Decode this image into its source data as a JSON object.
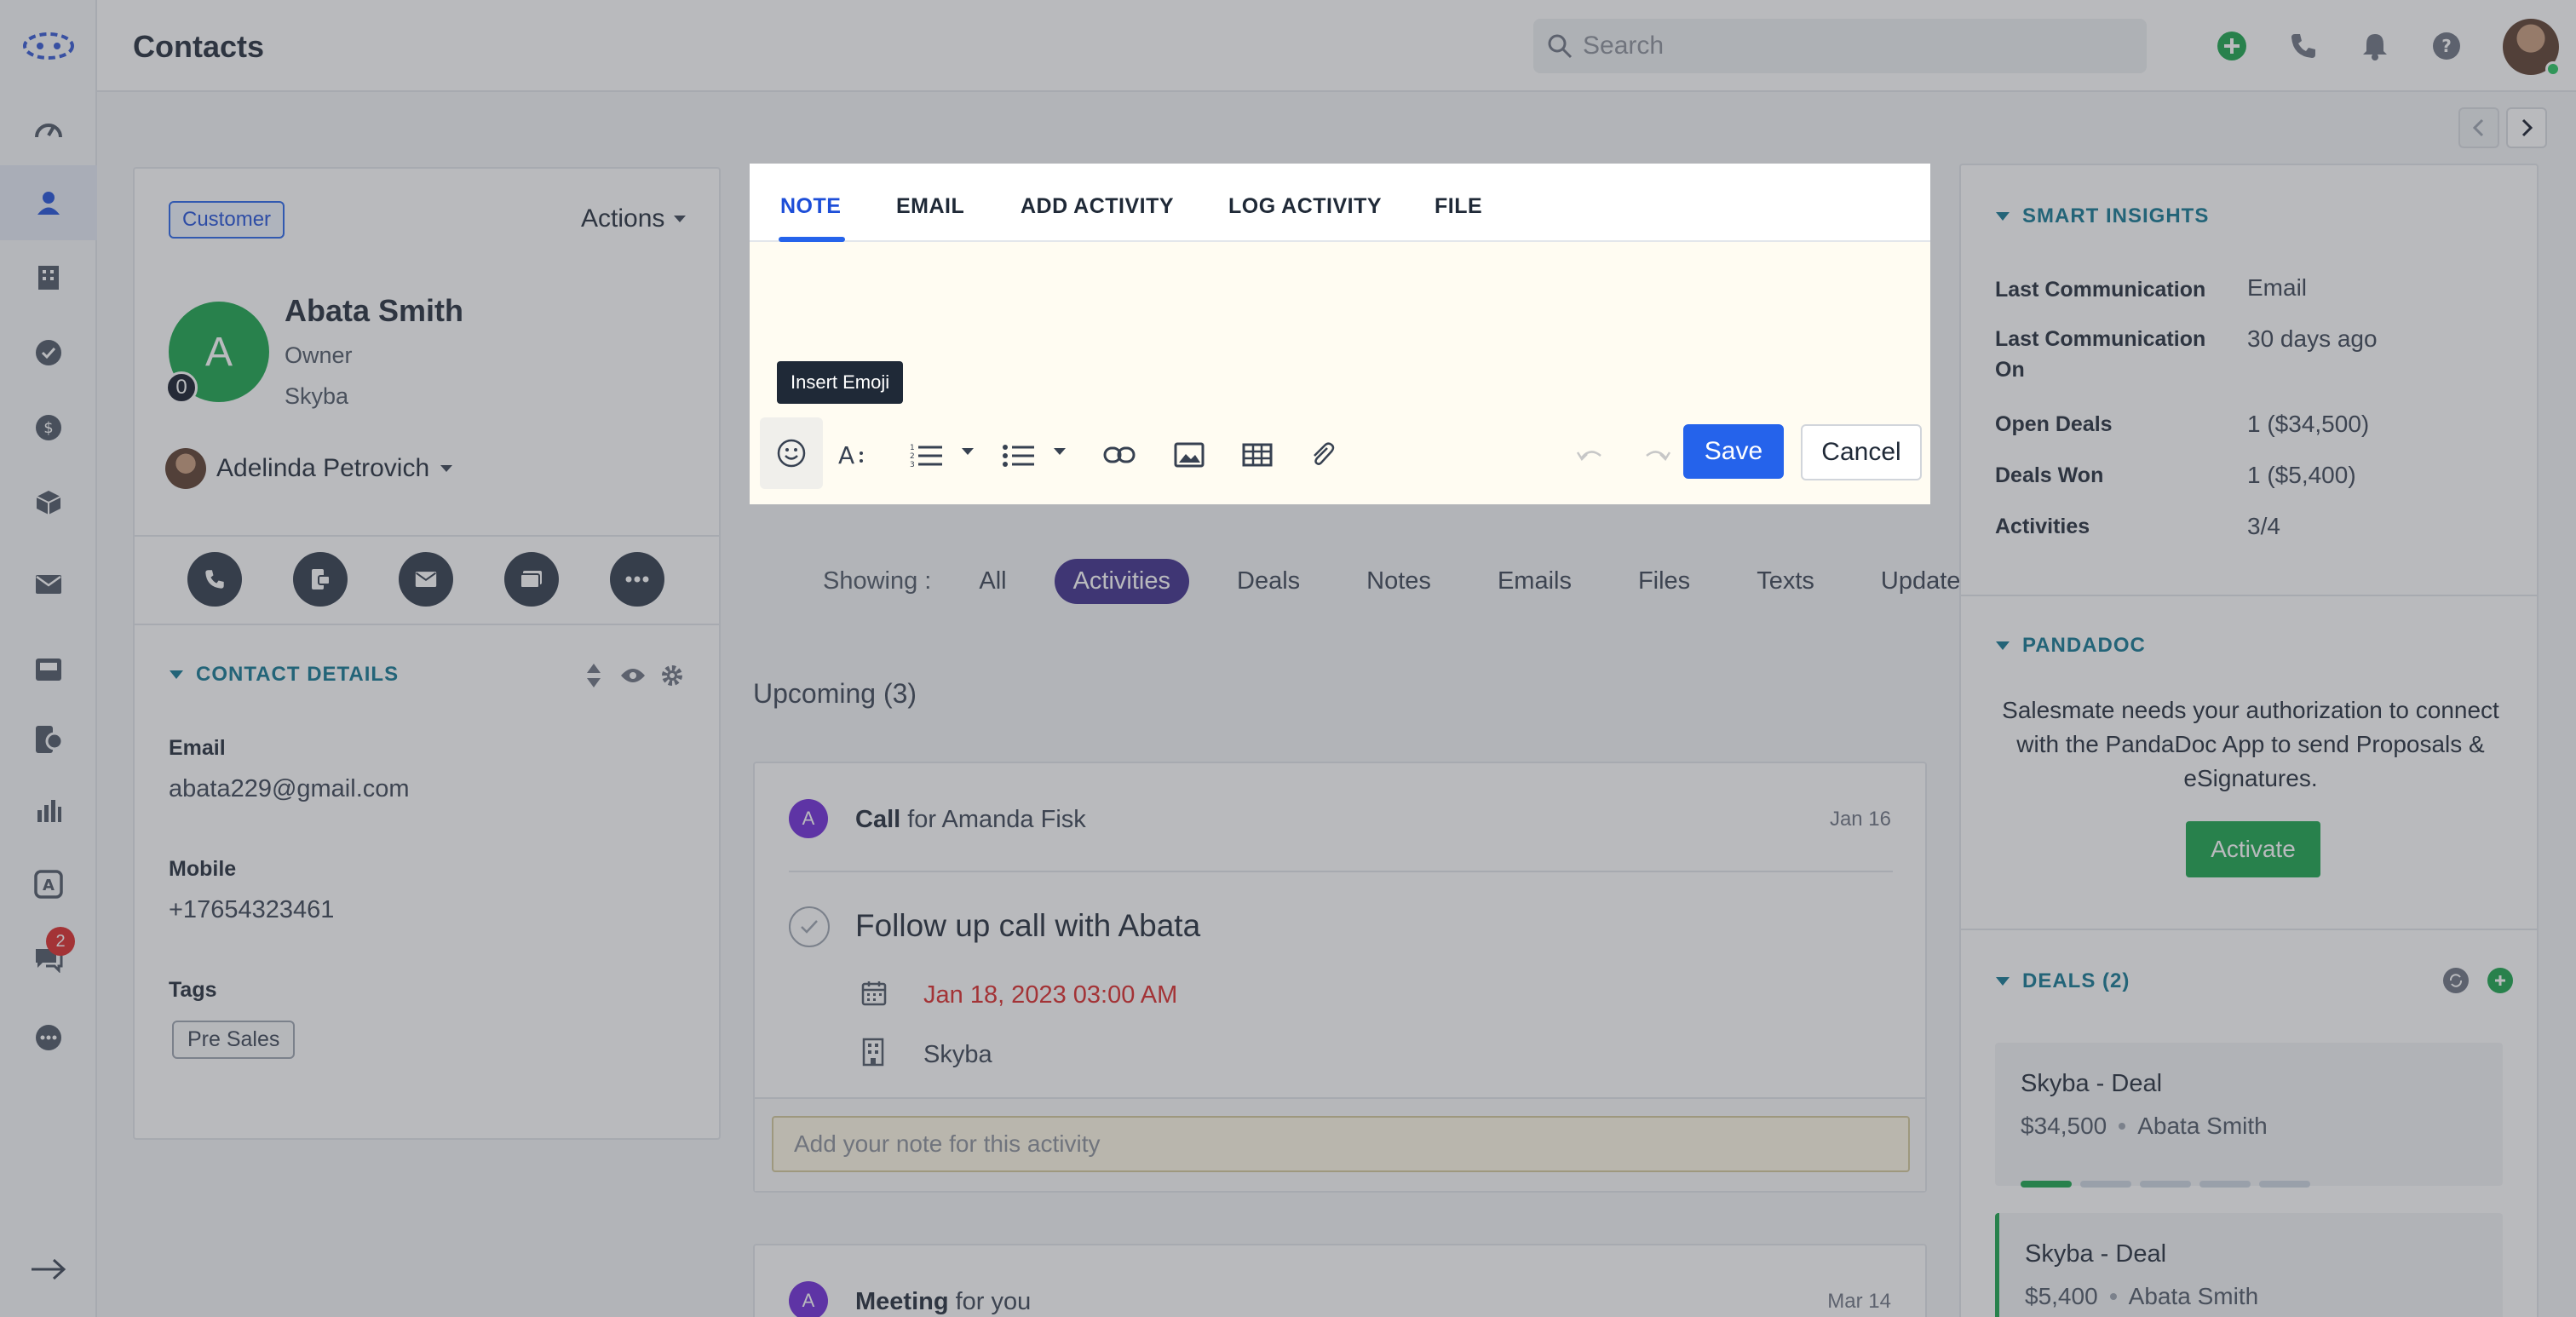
{
  "header": {
    "title": "Contacts",
    "search_placeholder": "Search"
  },
  "contact": {
    "badge": "Customer",
    "actions_label": "Actions",
    "avatar_letter": "A",
    "avatar_count": "0",
    "name": "Abata Smith",
    "role": "Owner",
    "company": "Skyba",
    "owner": "Adelinda Petrovich",
    "details_header": "CONTACT DETAILS",
    "email_label": "Email",
    "email": "abata229@gmail.com",
    "mobile_label": "Mobile",
    "mobile": "+17654323461",
    "tags_label": "Tags",
    "tags": [
      "Pre Sales"
    ]
  },
  "rail": {
    "badge_count": "2"
  },
  "composer": {
    "tabs": [
      "NOTE",
      "EMAIL",
      "ADD ACTIVITY",
      "LOG ACTIVITY",
      "FILE"
    ],
    "tooltip": "Insert Emoji",
    "save": "Save",
    "cancel": "Cancel"
  },
  "filters": {
    "label": "Showing :",
    "items": [
      "All",
      "Activities",
      "Deals",
      "Notes",
      "Emails",
      "Files",
      "Texts",
      "Updates"
    ],
    "active": "Activities"
  },
  "timeline": {
    "upcoming_title": "Upcoming (3)",
    "activity1": {
      "avatar": "A",
      "type": "Call",
      "for_text": "for Amanda Fisk",
      "date": "Jan 16",
      "subject": "Follow up call with Abata",
      "due": "Jan 18, 2023 03:00 AM",
      "company": "Skyba",
      "note_placeholder": "Add your note for this activity"
    },
    "activity2": {
      "avatar": "A",
      "type": "Meeting",
      "for_text": "for you",
      "date": "Mar 14"
    }
  },
  "smart_insights": {
    "header": "SMART INSIGHTS",
    "rows": [
      {
        "label": "Last Communication",
        "value": "Email"
      },
      {
        "label": "Last Communication On",
        "value": "30 days ago"
      },
      {
        "label": "Open Deals",
        "value": "1 ($34,500)"
      },
      {
        "label": "Deals Won",
        "value": "1 ($5,400)"
      },
      {
        "label": "Activities",
        "value": "3/4"
      }
    ]
  },
  "pandadoc": {
    "header": "PANDADOC",
    "text": "Salesmate needs your authorization to connect with the PandaDoc App to send Proposals & eSignatures.",
    "activate": "Activate"
  },
  "deals": {
    "header": "DEALS (2)",
    "items": [
      {
        "name": "Skyba - Deal",
        "amount": "$34,500",
        "person": "Abata Smith",
        "stages_done": 1,
        "stages_total": 5
      },
      {
        "name": "Skyba - Deal",
        "amount": "$5,400",
        "person": "Abata Smith"
      }
    ]
  },
  "colors": {
    "primary": "#2563eb",
    "accent_teal": "#0e7490",
    "success": "#16a34a",
    "activity_pill": "#3b2a8a"
  }
}
